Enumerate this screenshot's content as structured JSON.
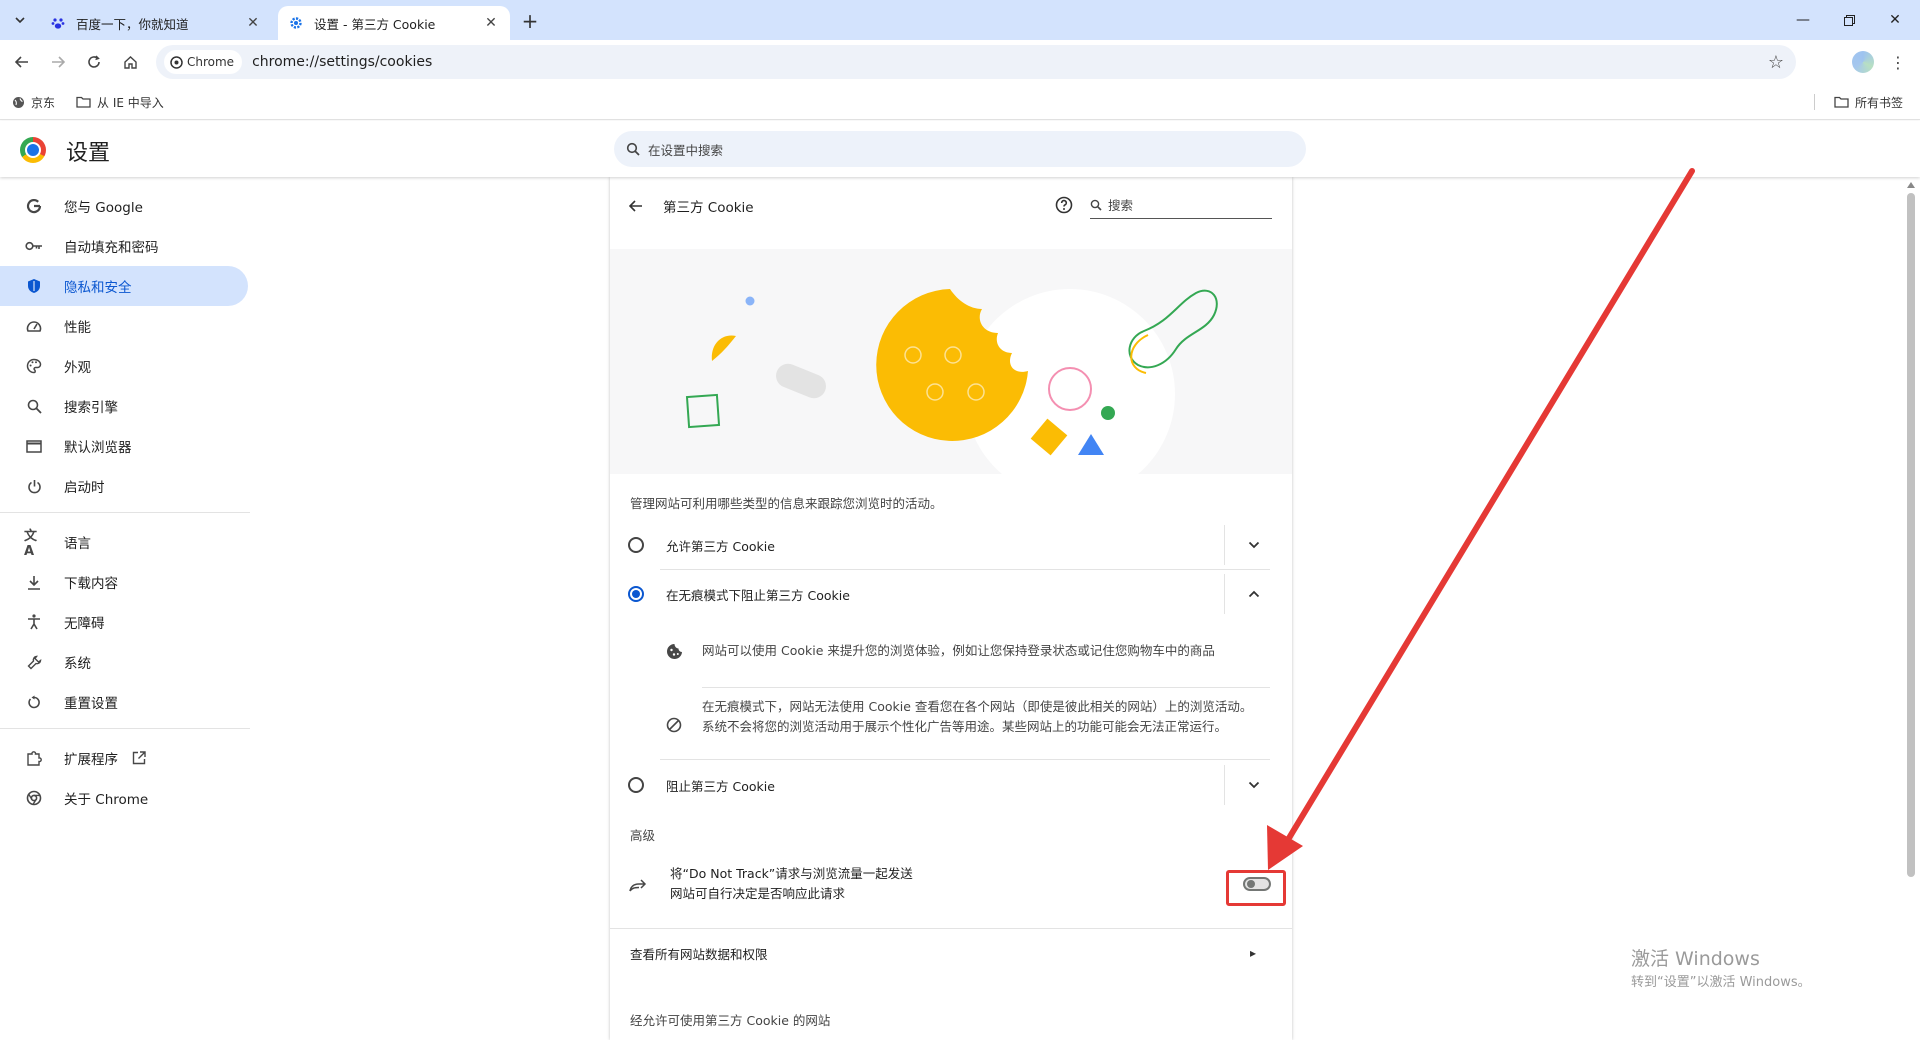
{
  "tabs": [
    {
      "title": "百度一下，你就知道",
      "favicon": "baidu-paw-icon",
      "active": false
    },
    {
      "title": "设置 - 第三方 Cookie",
      "favicon": "settings-gear-icon",
      "active": true
    }
  ],
  "toolbar": {
    "chip_label": "Chrome",
    "url": "chrome://settings/cookies"
  },
  "bookmarks": {
    "items": [
      {
        "label": "京东",
        "icon": "globe-icon"
      },
      {
        "label": "从 IE 中导入",
        "icon": "folder-icon"
      }
    ],
    "all_bookmarks": "所有书签"
  },
  "settings": {
    "title": "设置",
    "search_placeholder": "在设置中搜索"
  },
  "sidebar": {
    "items": [
      {
        "label": "您与 Google",
        "icon": "google-g-icon"
      },
      {
        "label": "自动填充和密码",
        "icon": "key-icon"
      },
      {
        "label": "隐私和安全",
        "icon": "shield-icon",
        "selected": true
      },
      {
        "label": "性能",
        "icon": "speedometer-icon"
      },
      {
        "label": "外观",
        "icon": "palette-icon"
      },
      {
        "label": "搜索引擎",
        "icon": "search-icon"
      },
      {
        "label": "默认浏览器",
        "icon": "browser-window-icon"
      },
      {
        "label": "启动时",
        "icon": "power-icon"
      },
      {
        "label": "语言",
        "icon": "translate-icon"
      },
      {
        "label": "下载内容",
        "icon": "download-icon"
      },
      {
        "label": "无障碍",
        "icon": "accessibility-icon"
      },
      {
        "label": "系统",
        "icon": "wrench-icon"
      },
      {
        "label": "重置设置",
        "icon": "reset-icon"
      },
      {
        "label": "扩展程序",
        "icon": "puzzle-icon"
      },
      {
        "label": "关于 Chrome",
        "icon": "chrome-icon"
      }
    ]
  },
  "page": {
    "title": "第三方 Cookie",
    "search_placeholder": "搜索",
    "description": "管理网站可利用哪些类型的信息来跟踪您浏览时的活动。",
    "options": [
      {
        "label": "允许第三方 Cookie",
        "selected": false,
        "expanded": false
      },
      {
        "label": "在无痕模式下阻止第三方 Cookie",
        "selected": true,
        "expanded": true
      },
      {
        "label": "阻止第三方 Cookie",
        "selected": false,
        "expanded": false
      }
    ],
    "expanded_details": [
      {
        "text": "网站可以使用 Cookie 来提升您的浏览体验，例如让您保持登录状态或记住您购物车中的商品",
        "icon": "cookie-icon"
      },
      {
        "line1": "在无痕模式下，网站无法使用 Cookie 查看您在各个网站（即使是彼此相关的网站）上的浏览活动。",
        "line2": "系统不会将您的浏览活动用于展示个性化广告等用途。某些网站上的功能可能会无法正常运行。",
        "icon": "block-icon"
      }
    ],
    "advanced_label": "高级",
    "dnt": {
      "title": "将“Do Not Track”请求与浏览流量一起发送",
      "subtitle": "网站可自行决定是否响应此请求",
      "enabled": false
    },
    "all_site_data": "查看所有网站数据和权限",
    "allowed_sites_header": "经允许可使用第三方 Cookie 的网站"
  },
  "watermark": {
    "line1": "激活 Windows",
    "line2": "转到“设置”以激活 Windows。"
  },
  "colors": {
    "accent": "#0b57d0",
    "selected_nav_bg": "#d3e3fd",
    "annotation_red": "#e53935"
  }
}
